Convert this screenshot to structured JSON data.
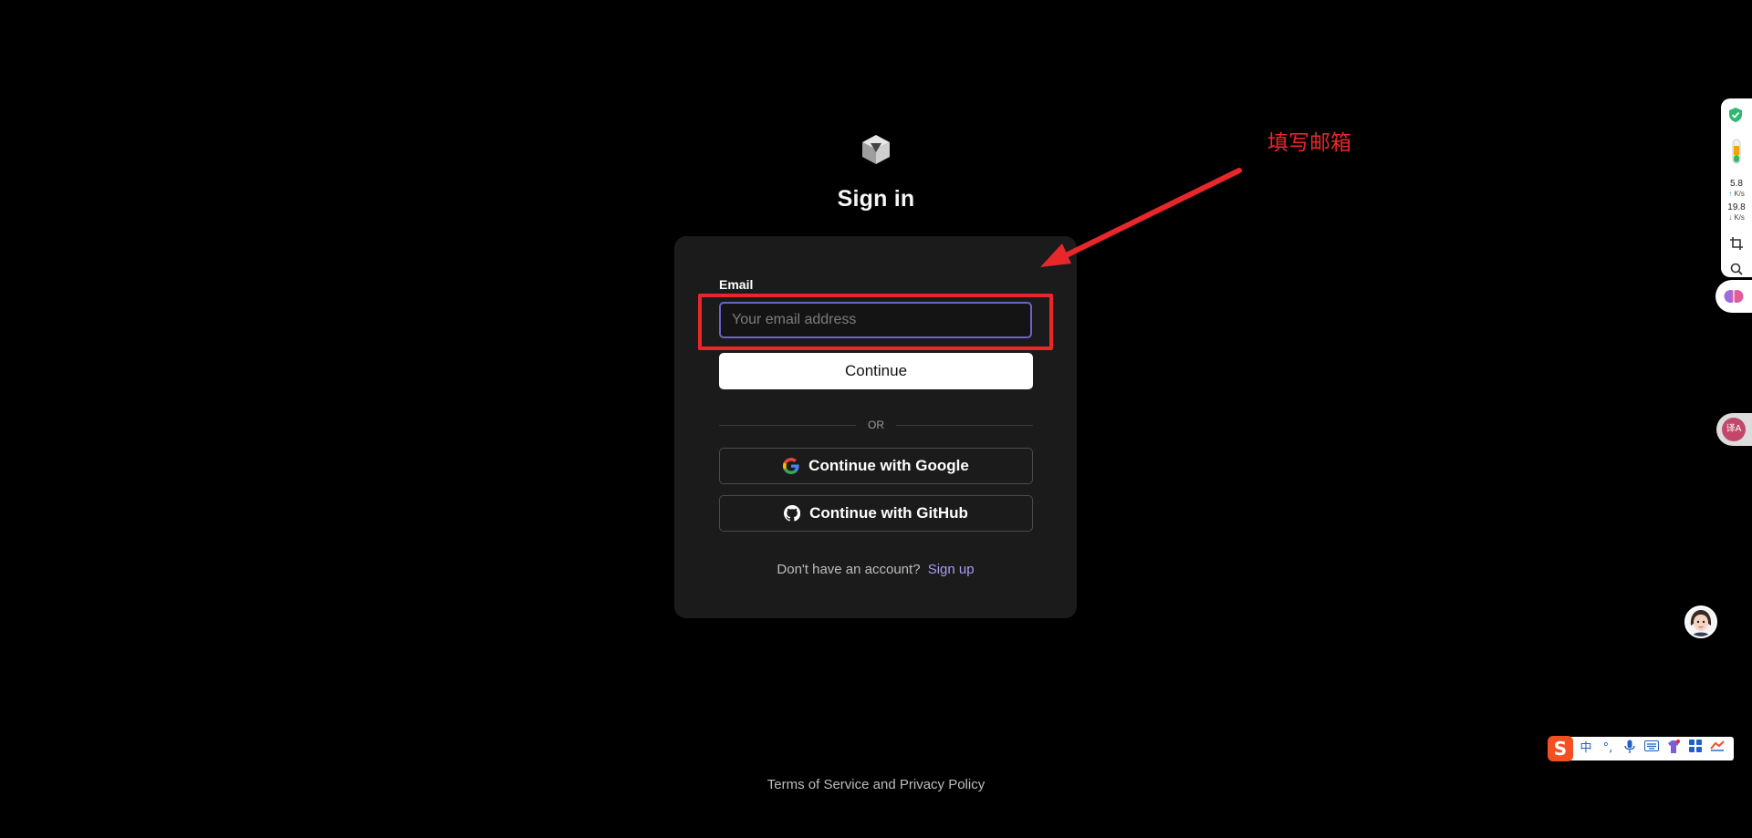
{
  "auth": {
    "title": "Sign in",
    "email_label": "Email",
    "email_value": "",
    "email_placeholder": "Your email address",
    "continue_label": "Continue",
    "divider_text": "OR",
    "google_label": "Continue with Google",
    "github_label": "Continue with GitHub",
    "no_account_text": "Don't have an account?",
    "signup_label": "Sign up"
  },
  "footer": {
    "terms_label": "Terms of Service",
    "and_text": "and",
    "privacy_label": "Privacy Policy"
  },
  "annotation": {
    "text": "填写邮箱",
    "color": "#e8272b"
  },
  "side_widget": {
    "upload_speed": "5.8",
    "upload_unit": "K/s",
    "download_speed": "19.8",
    "download_unit": "K/s"
  },
  "ime_toolbar": {
    "logo": "S",
    "mode": "中",
    "punct": "°,",
    "icons": [
      "microphone-icon",
      "keyboard-icon",
      "skin-icon",
      "toolbox-icon",
      "more-icon"
    ]
  },
  "colors": {
    "background": "#000000",
    "card": "#1b1b1b",
    "input_focus_border": "#6c62c8",
    "link": "#a99cf1"
  }
}
